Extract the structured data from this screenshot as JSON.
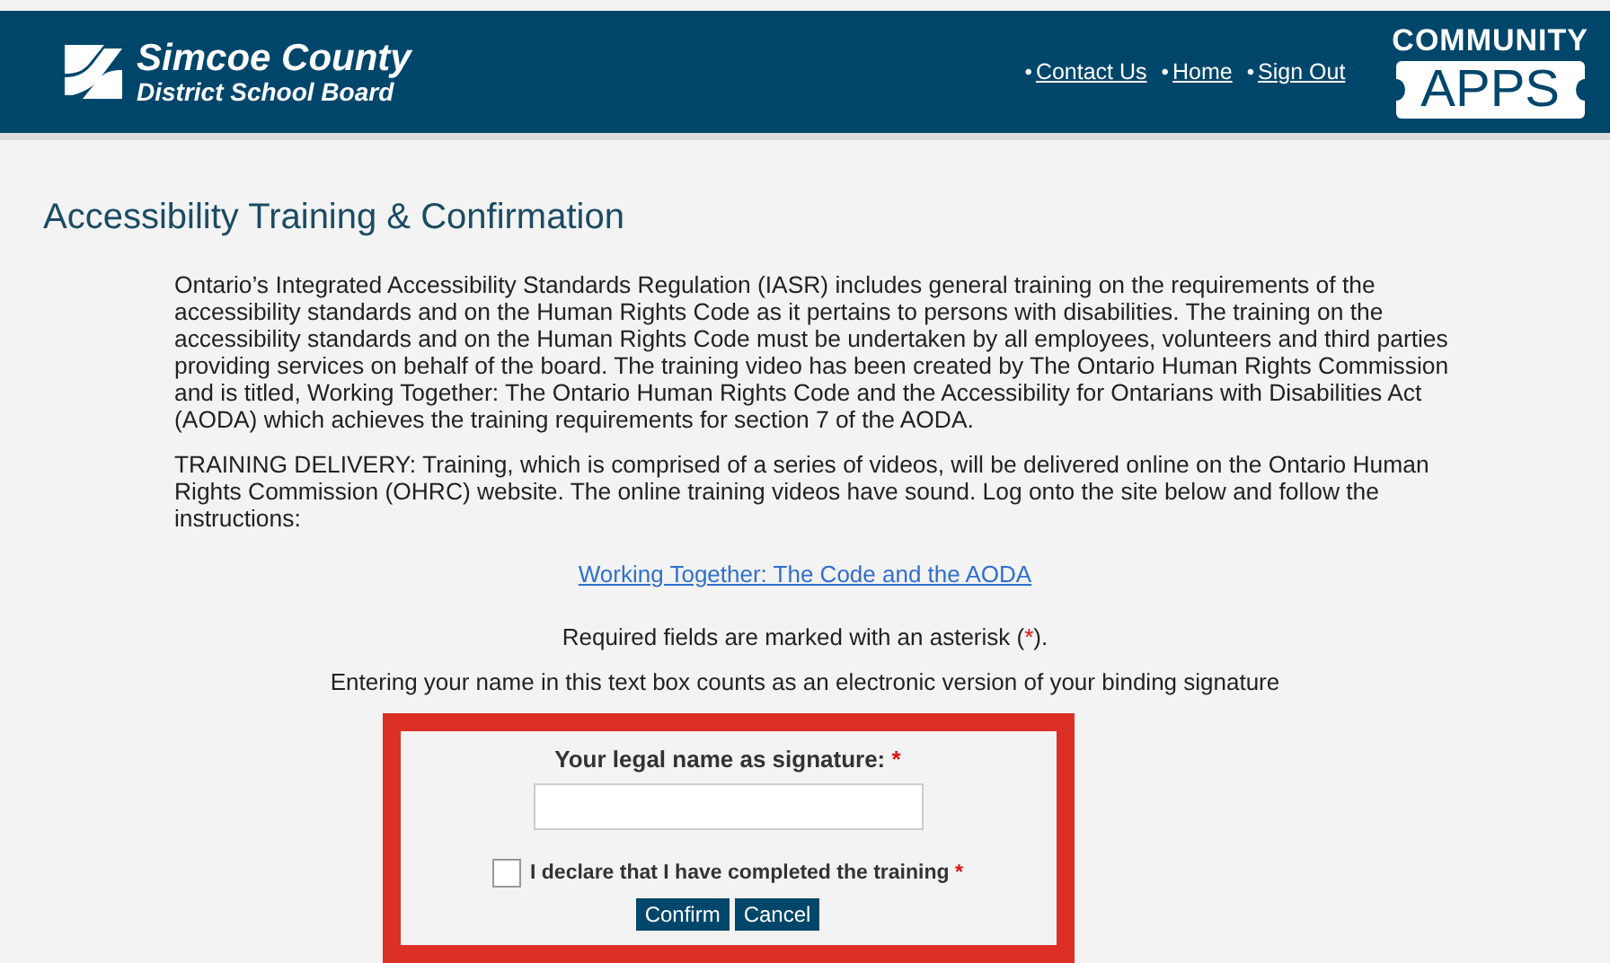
{
  "header": {
    "brand": {
      "line1": "Simcoe County",
      "line2": "District School Board"
    },
    "nav": [
      {
        "bullet": "•",
        "label": "Contact Us"
      },
      {
        "bullet": "•",
        "label": "Home"
      },
      {
        "bullet": "•",
        "label": "Sign Out"
      }
    ],
    "apps_logo": {
      "top": "COMMUNITY",
      "badge": "APPS"
    }
  },
  "page_title": "Accessibility Training & Confirmation",
  "paragraphs": [
    "Ontario’s Integrated Accessibility Standards Regulation (IASR) includes general training on the requirements of the accessibility standards and on the Human Rights Code as it pertains to persons with disabilities. The training on the accessibility standards and on the Human Rights Code must be undertaken by all employees, volunteers and third parties providing services on behalf of the board. The training video has been created by The Ontario Human Rights Commission and is titled, Working Together: The Ontario Human Rights Code and the Accessibility for Ontarians with Disabilities Act (AODA) which achieves the training requirements for section 7 of the AODA.",
    "TRAINING DELIVERY: Training, which is comprised of a series of videos, will be delivered online on the Ontario Human Rights Commission (OHRC) website. The online training videos have sound. Log onto the site below and follow the instructions:"
  ],
  "training_link": "Working Together: The Code and the AODA",
  "required_note": {
    "before": "Required fields are marked with an asterisk (",
    "mark": "*",
    "after": ")."
  },
  "signature_note": "Entering your name in this text box counts as an electronic version of your binding signature",
  "form": {
    "highlighted": true,
    "signature": {
      "label": "Your legal name as signature:",
      "required_mark": "*"
    },
    "declaration": {
      "label": "I declare that I have completed the training",
      "required_mark": "*",
      "checked": false
    },
    "buttons": [
      "Confirm",
      "Cancel"
    ]
  }
}
